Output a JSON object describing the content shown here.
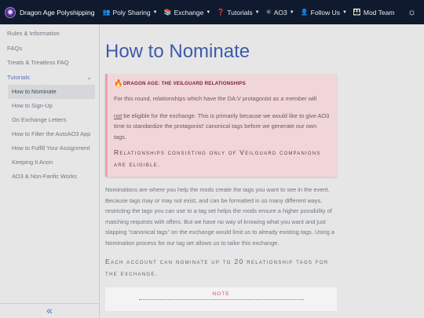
{
  "navbar": {
    "brand": "Dragon Age Polyshipping",
    "items": [
      {
        "label": "Poly Sharing",
        "icon": "users-icon",
        "caret": true
      },
      {
        "label": "Exchange",
        "icon": "books-icon",
        "caret": true
      },
      {
        "label": "Tutorials",
        "icon": "question-icon",
        "caret": true
      },
      {
        "label": "AO3",
        "icon": "ao3-icon",
        "caret": true
      },
      {
        "label": "Follow Us",
        "icon": "user-plus-icon",
        "caret": true
      },
      {
        "label": "Mod Team",
        "icon": "team-icon",
        "caret": false
      }
    ]
  },
  "sidebar": {
    "items": [
      "Rules & Information",
      "FAQs",
      "Treats & Treatless FAQ"
    ],
    "expanded_section": "Tutorials",
    "sub_items": [
      "How to Nominate",
      "How to Sign-Up",
      "On Exchange Letters",
      "How to Filter the AutoAO3 App",
      "How to Fulfill Your Assignment",
      "Keeping It Anon",
      "AO3 & Non-Fanfic Works"
    ],
    "active_sub_item": "How to Nominate",
    "collapse_icon": "«"
  },
  "main": {
    "title": "How to Nominate",
    "alert": {
      "heading": "DRAGON AGE: THE VEILGUARD RELATIONSHIPS",
      "p1": "For this round, relationships which have the DA:V protagonist as a member will",
      "p2_underlined": "not",
      "p2_rest": " be eligible for the exchange. This is primarily because we would like to give AO3 time to standardize the protagonist' canonical tags before we generate our own tags.",
      "p3": "Relationships consisting only of Veilguard companions are eligible."
    },
    "body": "Nominations are where you help the mods create the tags you want to see in the event. Because tags may or may not exist, and can be formatted in so many different ways, restricting the tags you can use to a tag set helps the mods ensure a higher possibility of matching requests with offers. But we have no way of knowing what you want and just slapping \"canonical tags\" on the exchange would limit us to already existing tags. Using a Nomination process for our tag set allows us to tailor this exchange.",
    "caps_line": "Each account can nominate up to 20 relationship tags for the exchange.",
    "note_title": "NOTE"
  }
}
